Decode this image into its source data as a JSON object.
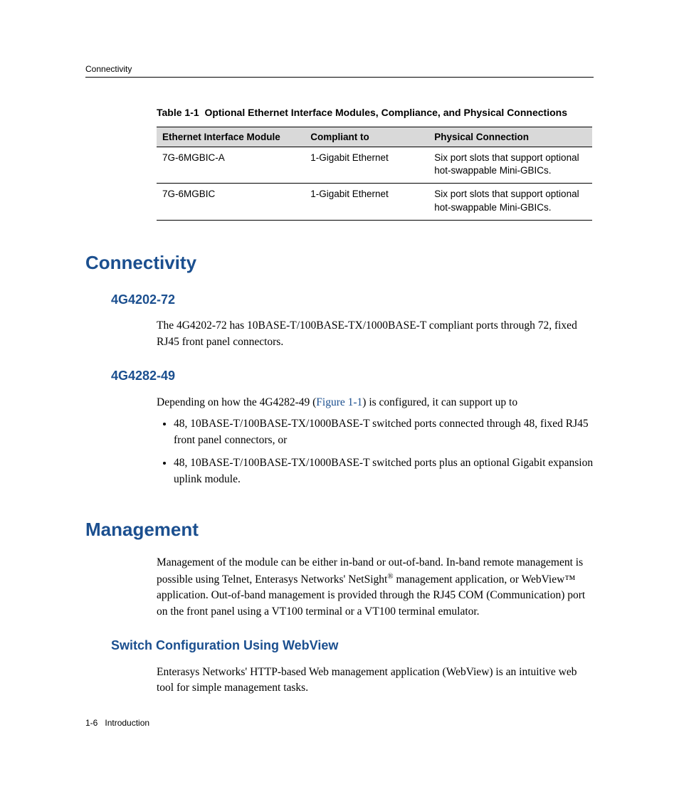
{
  "header": {
    "running": "Connectivity"
  },
  "table": {
    "caption_strong": "Table 1-1",
    "caption_rest": "Optional Ethernet Interface Modules, Compliance, and Physical Connections",
    "headers": {
      "module": "Ethernet Interface Module",
      "compliant": "Compliant to",
      "physical": "Physical Connection"
    },
    "rows": [
      {
        "module": "7G-6MGBIC-A",
        "compliant": "1-Gigabit Ethernet",
        "physical": "Six port slots that support optional hot-swappable Mini-GBICs."
      },
      {
        "module": "7G-6MGBIC",
        "compliant": "1-Gigabit Ethernet",
        "physical": "Six port slots that support optional hot-swappable Mini-GBICs."
      }
    ]
  },
  "sections": {
    "connectivity": {
      "title": "Connectivity",
      "sub1": {
        "title": "4G4202-72",
        "para": "The 4G4202-72 has 10BASE-T/100BASE-TX/1000BASE-T compliant ports through 72, fixed RJ45 front panel connectors."
      },
      "sub2": {
        "title": "4G4282-49",
        "para_pre": "Depending on how the 4G4282-49 (",
        "link": "Figure 1-1",
        "para_post": ") is configured, it can support up to",
        "bullets": [
          "48, 10BASE-T/100BASE-TX/1000BASE-T switched ports connected through 48, fixed RJ45 front panel connectors, or",
          "48, 10BASE-T/100BASE-TX/1000BASE-T switched ports plus an optional Gigabit expansion uplink module."
        ]
      }
    },
    "management": {
      "title": "Management",
      "para_1": "Management of the module can be either in-band or out-of-band. In-band remote management is possible using Telnet, Enterasys Networks' NetSight",
      "para_2": " management application, or WebView™ application. Out-of-band management is provided through the RJ45 COM (Communication) port on the front panel using a VT100 terminal or a VT100 terminal emulator.",
      "sub1": {
        "title": "Switch Configuration Using WebView",
        "para": "Enterasys Networks' HTTP-based Web management application (WebView) is an intuitive web tool for simple management tasks."
      }
    }
  },
  "footer": {
    "page": "1-6",
    "label": "Introduction"
  }
}
